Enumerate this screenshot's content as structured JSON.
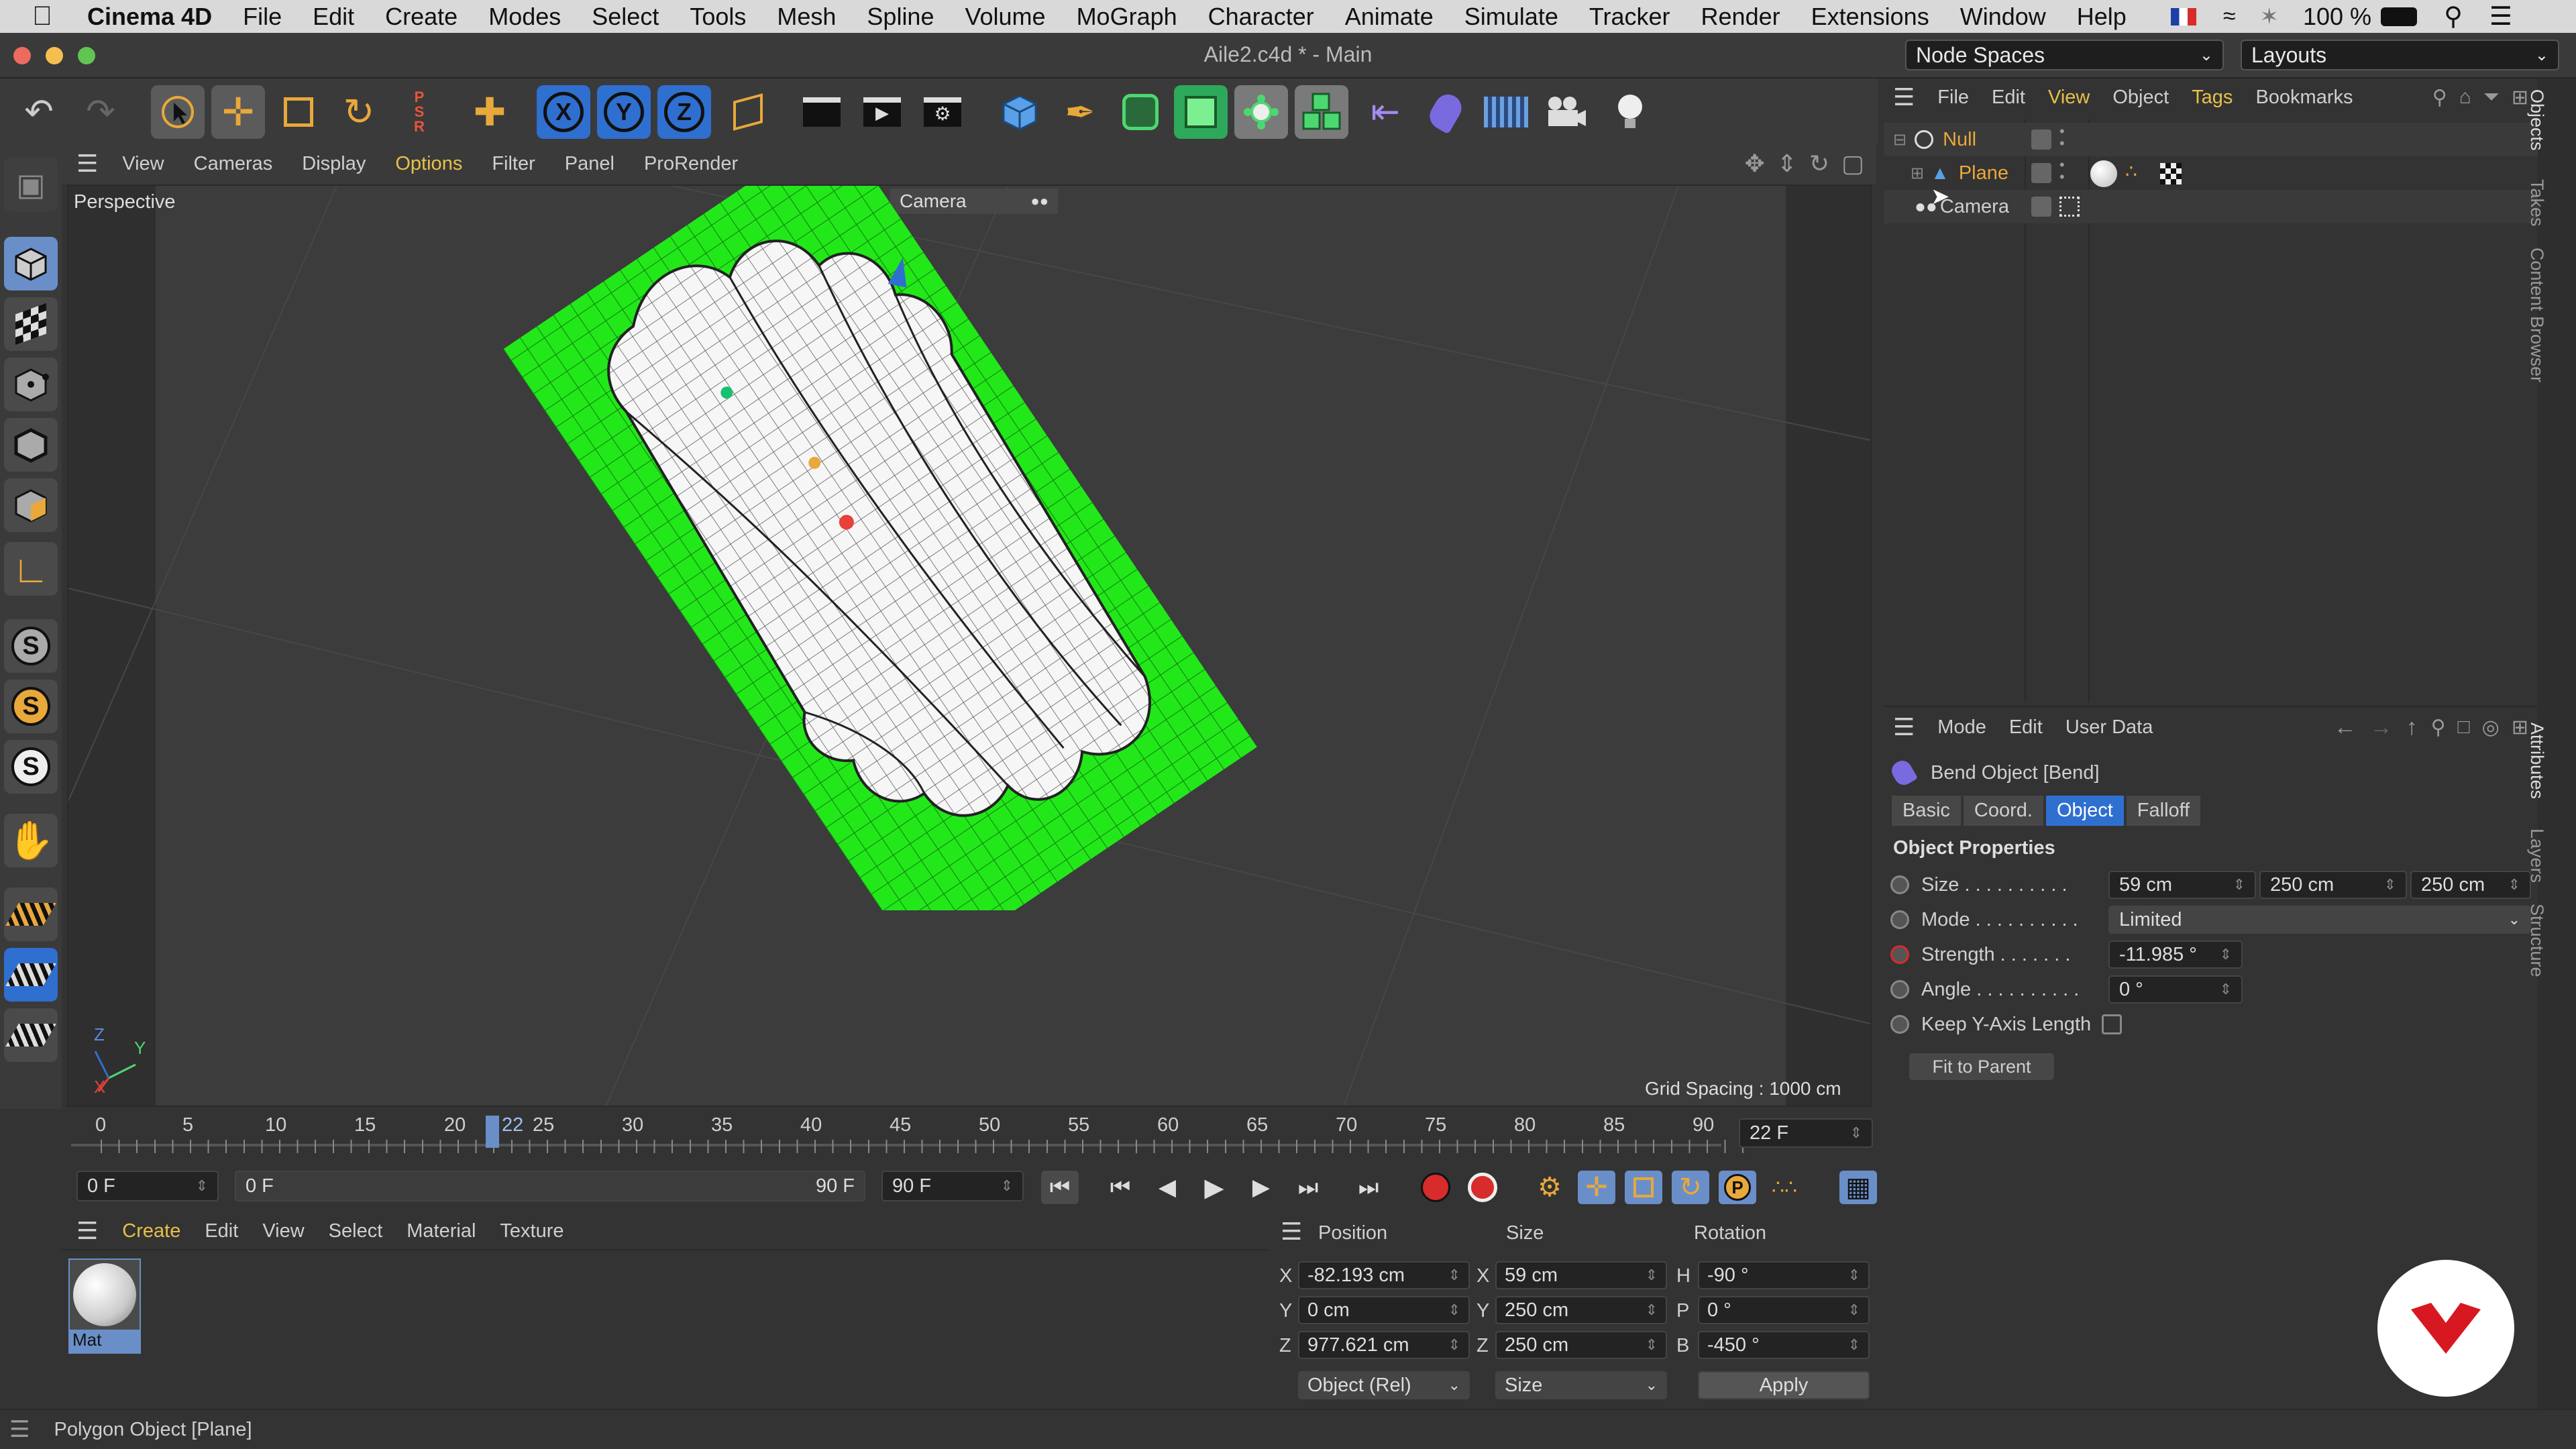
{
  "menubar": {
    "app": "Cinema 4D",
    "items": [
      "File",
      "Edit",
      "Create",
      "Modes",
      "Select",
      "Tools",
      "Mesh",
      "Spline",
      "Volume",
      "MoGraph",
      "Character",
      "Animate",
      "Simulate",
      "Tracker",
      "Render",
      "Extensions",
      "Window",
      "Help"
    ],
    "battery": "100 %"
  },
  "titlebar": {
    "title": "Aile2.c4d * - Main",
    "node_spaces": "Node Spaces",
    "layouts": "Layouts"
  },
  "toolbar": {
    "axis_x": "X",
    "axis_y": "Y",
    "axis_z": "Z"
  },
  "viewport": {
    "menu": [
      "View",
      "Cameras",
      "Display",
      "Options",
      "Filter",
      "Panel",
      "ProRender"
    ],
    "label": "Perspective",
    "camera": "Camera",
    "grid_spacing": "Grid Spacing : 1000 cm",
    "axis_labels": {
      "z": "Z",
      "y": "Y",
      "x": "X"
    }
  },
  "timeline": {
    "ticks": [
      "0",
      "5",
      "10",
      "15",
      "20",
      "25",
      "30",
      "35",
      "40",
      "45",
      "50",
      "55",
      "60",
      "65",
      "70",
      "75",
      "80",
      "85",
      "90"
    ],
    "current_marker": "22",
    "current_frame": "22 F",
    "start_frame": "0 F",
    "range_start": "0 F",
    "range_end": "90 F",
    "end_frame": "90 F"
  },
  "materials": {
    "menu": [
      "Create",
      "Edit",
      "View",
      "Select",
      "Material",
      "Texture"
    ],
    "items": [
      {
        "name": "Mat"
      }
    ]
  },
  "coords": {
    "headers": {
      "position": "Position",
      "size": "Size",
      "rotation": "Rotation"
    },
    "rows": [
      {
        "pl": "X",
        "pv": "-82.193 cm",
        "sl": "X",
        "sv": "59 cm",
        "rl": "H",
        "rv": "-90 °"
      },
      {
        "pl": "Y",
        "pv": "0 cm",
        "sl": "Y",
        "sv": "250 cm",
        "rl": "P",
        "rv": "0 °"
      },
      {
        "pl": "Z",
        "pv": "977.621 cm",
        "sl": "Z",
        "sv": "250 cm",
        "rl": "B",
        "rv": "-450 °"
      }
    ],
    "mode": "Object (Rel)",
    "size_mode": "Size",
    "apply": "Apply"
  },
  "objects": {
    "menu": [
      "File",
      "Edit",
      "View",
      "Object",
      "Tags",
      "Bookmarks"
    ],
    "items": [
      {
        "name": "Null",
        "color": "#e8a83a"
      },
      {
        "name": "Plane",
        "color": "#e8a83a"
      },
      {
        "name": "Camera",
        "color": "#cfcfcf"
      }
    ]
  },
  "attributes": {
    "menu": [
      "Mode",
      "Edit",
      "User Data"
    ],
    "object_title": "Bend Object [Bend]",
    "tabs": [
      "Basic",
      "Coord.",
      "Object",
      "Falloff"
    ],
    "section": "Object Properties",
    "size_label": "Size . . . . . . . . . .",
    "size_values": [
      "59 cm",
      "250 cm",
      "250 cm"
    ],
    "mode_label": "Mode . . . . . . . . . .",
    "mode_value": "Limited",
    "strength_label": "Strength . . . . . . .",
    "strength_value": "-11.985 °",
    "angle_label": "Angle . . . . . . . . . .",
    "angle_value": "0 °",
    "keep_label": "Keep Y-Axis Length",
    "fit_button": "Fit to Parent"
  },
  "sidetabs": [
    "Objects",
    "Takes",
    "Content Browser",
    "Attributes",
    "Layers",
    "Structure"
  ],
  "status": "Polygon Object [Plane]",
  "colors": {
    "accent": "#e8a83a",
    "blue": "#2f6fd0",
    "green": "#22e81a"
  }
}
